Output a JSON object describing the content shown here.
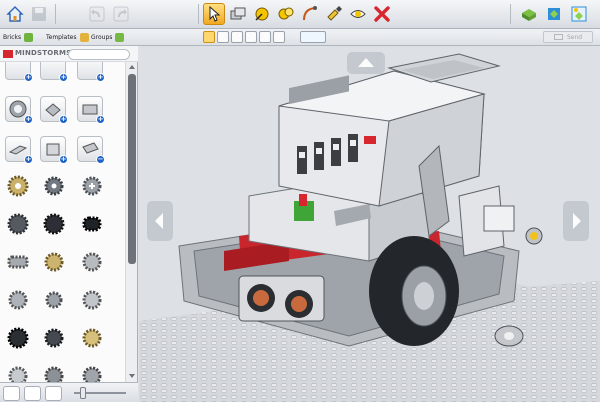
{
  "subbar": {
    "tabs": [
      {
        "label": "Bricks",
        "icon": "bricks-icon"
      },
      {
        "label": "Templates",
        "icon": "templates-icon"
      },
      {
        "label": "Groups",
        "icon": "groups-icon"
      }
    ],
    "send_label": "Send"
  },
  "palette": {
    "brand_text": "MINDSTORMS",
    "search_value": ""
  },
  "colors": {
    "active_tool": "#f2a823",
    "brand_red": "#d8262e",
    "badge_blue": "#1f63c8",
    "canvas_bg": "#dde1e6"
  },
  "toolbar": {
    "icons": [
      "home-icon",
      "save-icon",
      "undo-icon",
      "redo-icon",
      "select-icon",
      "clone-icon",
      "hinge-icon",
      "hinge-align-icon",
      "flex-icon",
      "paint-icon",
      "hide-icon",
      "delete-icon",
      "build-mode-icon",
      "view-mode-icon",
      "building-guide-icon"
    ]
  }
}
